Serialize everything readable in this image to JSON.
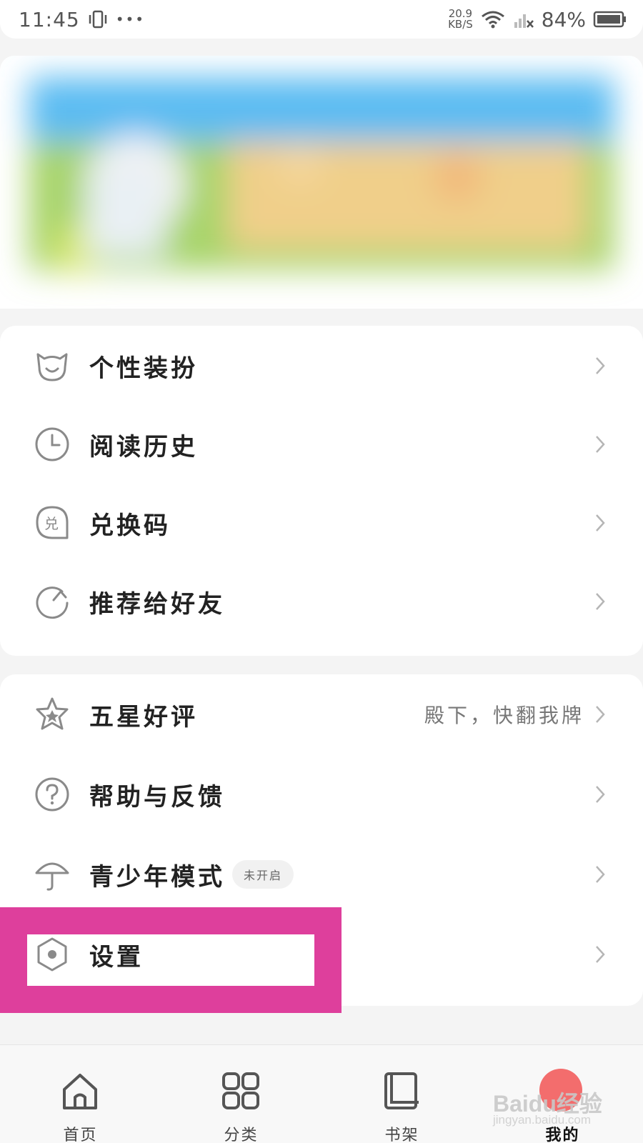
{
  "status_bar": {
    "time": "11:45",
    "dots": "•••",
    "net_speed_value": "20.9",
    "net_speed_unit": "KB/S",
    "battery": "84%"
  },
  "menu_group_1": [
    {
      "label": "个性装扮",
      "icon": "cat-face-icon"
    },
    {
      "label": "阅读历史",
      "icon": "clock-icon"
    },
    {
      "label": "兑换码",
      "icon": "redeem-code-icon"
    },
    {
      "label": "推荐给好友",
      "icon": "share-icon"
    }
  ],
  "menu_group_2": [
    {
      "label": "五星好评",
      "icon": "star-icon",
      "hint": "殿下，快翻我牌"
    },
    {
      "label": "帮助与反馈",
      "icon": "help-icon"
    },
    {
      "label": "青少年模式",
      "icon": "umbrella-icon",
      "badge": "未开启"
    },
    {
      "label": "设置",
      "icon": "settings-hex-icon"
    }
  ],
  "bottom_nav": [
    {
      "label": "首页",
      "icon": "home-icon"
    },
    {
      "label": "分类",
      "icon": "category-grid-icon"
    },
    {
      "label": "书架",
      "icon": "bookshelf-icon"
    },
    {
      "label": "我的",
      "icon": "profile-icon",
      "active": true
    }
  ],
  "watermark": {
    "text": "Baidu经验",
    "sub": "jingyan.baidu.com"
  },
  "colors": {
    "highlight": "#de3f9c",
    "accent": "#f36d6d"
  }
}
